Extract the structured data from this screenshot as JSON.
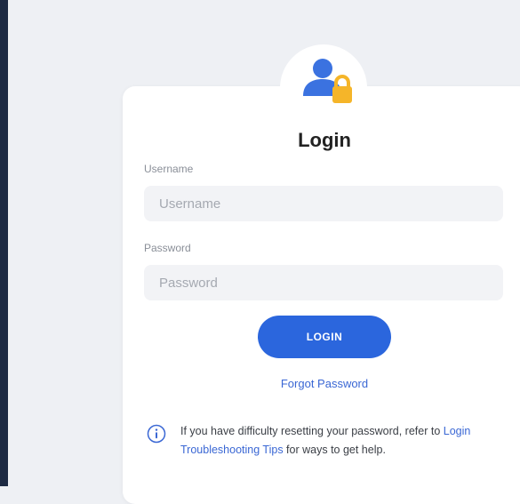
{
  "login": {
    "title": "Login",
    "username_label": "Username",
    "username_placeholder": "Username",
    "password_label": "Password",
    "password_placeholder": "Password",
    "login_button": "LOGIN",
    "forgot_link": "Forgot Password",
    "info": {
      "text_before": "If you have difficulty resetting your password, refer to ",
      "link_text": "Login Troubleshooting Tips",
      "text_after": " for ways to get help."
    }
  },
  "colors": {
    "accent": "#2b66dd",
    "lock": "#f5b529",
    "rail": "#1d2a43"
  },
  "icons": {
    "avatar": "user-lock-icon",
    "info": "info-circle-icon"
  }
}
